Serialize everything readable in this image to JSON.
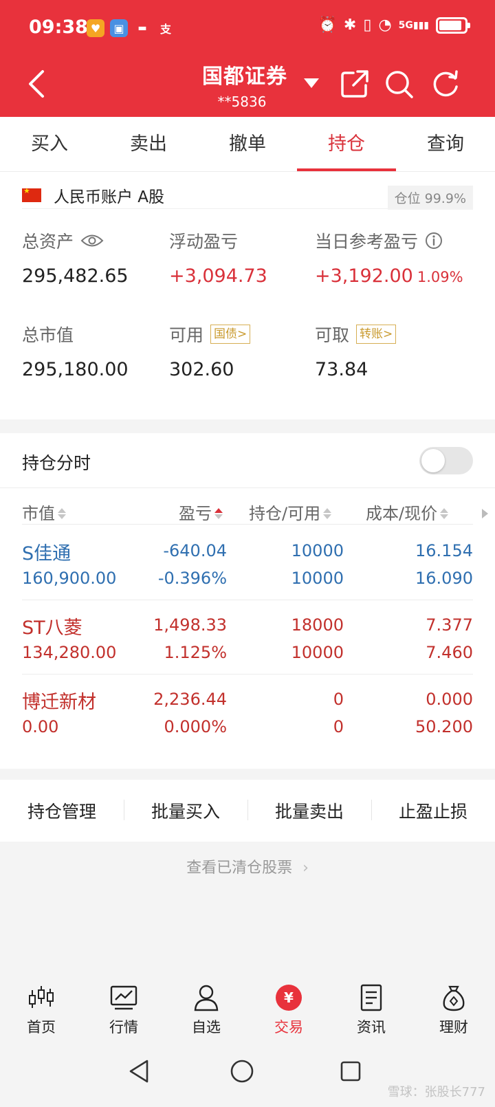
{
  "status_bar": {
    "time": "09:38",
    "network": "5G"
  },
  "header": {
    "broker_name": "国都证券",
    "account": "**5836"
  },
  "tabs": [
    {
      "label": "买入"
    },
    {
      "label": "卖出"
    },
    {
      "label": "撤单"
    },
    {
      "label": "持仓",
      "active": true
    },
    {
      "label": "查询"
    }
  ],
  "account": {
    "label": "人民币账户 A股",
    "position_ratio": "仓位 99.9%",
    "total_assets_label": "总资产",
    "total_assets": "295,482.65",
    "floating_pl_label": "浮动盈亏",
    "floating_pl": "+3,094.73",
    "daily_pl_label": "当日参考盈亏",
    "daily_pl": "+3,192.00",
    "daily_pl_pct": "1.09%",
    "market_value_label": "总市值",
    "market_value": "295,180.00",
    "available_label": "可用",
    "available_tag": "国债>",
    "available": "302.60",
    "withdrawable_label": "可取",
    "withdrawable_tag": "转账>",
    "withdrawable": "73.84"
  },
  "chart_toggle": {
    "label": "持仓分时",
    "on": false
  },
  "table": {
    "headers": {
      "col1": "市值",
      "col2": "盈亏",
      "col3": "持仓/可用",
      "col4": "成本/现价"
    },
    "rows": [
      {
        "name": "S佳通",
        "market_value": "160,900.00",
        "pl": "-640.04",
        "pl_pct": "-0.396%",
        "position": "10000",
        "available": "10000",
        "cost": "16.154",
        "price": "16.090",
        "color": "#2f6fb0"
      },
      {
        "name": "ST八菱",
        "market_value": "134,280.00",
        "pl": "1,498.33",
        "pl_pct": "1.125%",
        "position": "18000",
        "available": "10000",
        "cost": "7.377",
        "price": "7.460",
        "color": "#c2302c"
      },
      {
        "name": "博迁新材",
        "market_value": "0.00",
        "pl": "2,236.44",
        "pl_pct": "0.000%",
        "position": "0",
        "available": "0",
        "cost": "0.000",
        "price": "50.200",
        "color": "#c2302c"
      }
    ]
  },
  "actions": [
    {
      "label": "持仓管理"
    },
    {
      "label": "批量买入"
    },
    {
      "label": "批量卖出"
    },
    {
      "label": "止盈止损"
    }
  ],
  "cleared_link": "查看已清仓股票",
  "bottom_nav": [
    {
      "label": "首页",
      "icon": "candlestick-icon"
    },
    {
      "label": "行情",
      "icon": "market-chart-icon"
    },
    {
      "label": "自选",
      "icon": "user-watchlist-icon"
    },
    {
      "label": "交易",
      "icon": "yuan-trade-icon",
      "active": true
    },
    {
      "label": "资讯",
      "icon": "news-icon"
    },
    {
      "label": "理财",
      "icon": "money-bag-icon"
    }
  ],
  "watermark": "雪球：张股长777",
  "colors": {
    "brand_red": "#e8323c",
    "loss_blue": "#2f6fb0",
    "gain_red": "#c2302c",
    "tag_gold": "#c99a2e"
  }
}
